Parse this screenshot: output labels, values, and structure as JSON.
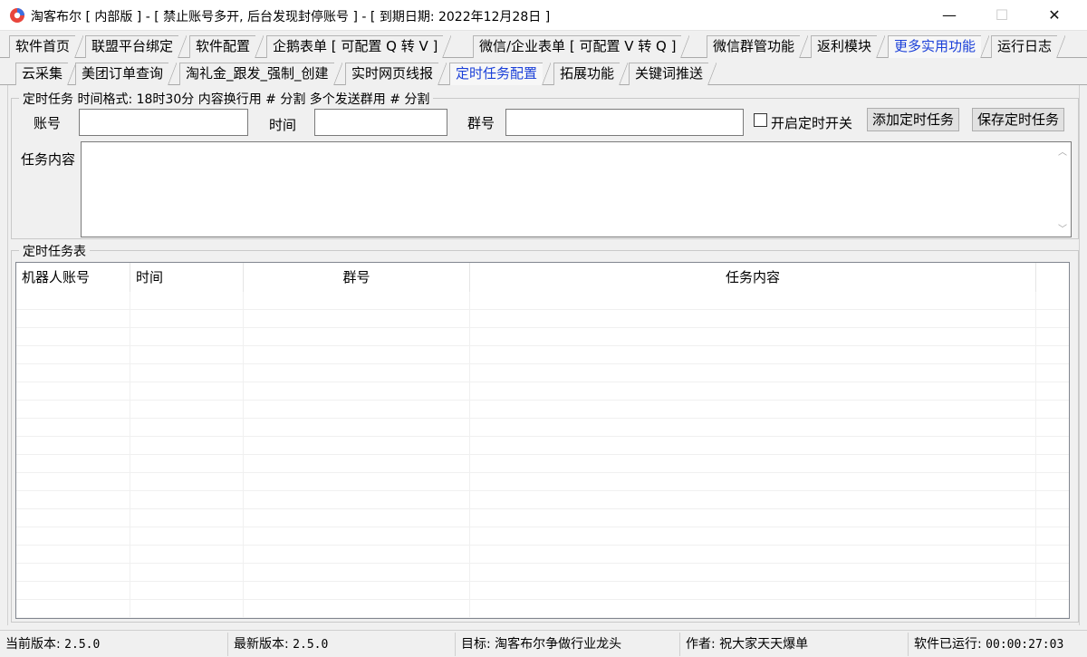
{
  "window": {
    "title": "淘客布尔 [ 内部版 ] - [ 禁止账号多开, 后台发现封停账号 ] - [ 到期日期: 2022年12月28日 ]",
    "minimize_glyph": "—",
    "maximize_glyph": "☐",
    "close_glyph": "✕"
  },
  "main_tabs": [
    {
      "label": "软件首页"
    },
    {
      "label": "联盟平台绑定"
    },
    {
      "label": "软件配置"
    },
    {
      "label": "企鹅表单 [ 可配置 Q 转 V ]"
    },
    {
      "label": "微信/企业表单 [ 可配置 V 转 Q ]"
    },
    {
      "label": "微信群管功能"
    },
    {
      "label": "返利模块"
    },
    {
      "label": "更多实用功能"
    },
    {
      "label": "运行日志"
    }
  ],
  "sub_tabs": [
    {
      "label": "云采集"
    },
    {
      "label": "美团订单查询"
    },
    {
      "label": "淘礼金_跟发_强制_创建"
    },
    {
      "label": "实时网页线报"
    },
    {
      "label": "定时任务配置"
    },
    {
      "label": "拓展功能"
    },
    {
      "label": "关键词推送"
    }
  ],
  "task_group": {
    "legend": "定时任务    时间格式: 18时30分  内容换行用 # 分割  多个发送群用 # 分割",
    "account_label": "账号",
    "account_value": "",
    "time_label": "时间",
    "time_value": "",
    "group_label": "群号",
    "group_value": "",
    "enable_label": "开启定时开关",
    "enable_checked": false,
    "add_button": "添加定时任务",
    "save_button": "保存定时任务",
    "content_label": "任务内容",
    "content_value": ""
  },
  "table_group": {
    "legend": "定时任务表",
    "columns": [
      "机器人账号",
      "时间",
      "群号",
      "任务内容"
    ]
  },
  "status": {
    "current_version_label": "当前版本:",
    "current_version": "2.5.0",
    "latest_version_label": "最新版本:",
    "latest_version": "2.5.0",
    "goal": "目标: 淘客布尔争做行业龙头",
    "author": "作者: 祝大家天天爆单",
    "runtime_label": "软件已运行:",
    "runtime": "00:00:27:03"
  },
  "colors": {
    "active_tab": "#1a3fd8",
    "background": "#f0f0f0"
  }
}
